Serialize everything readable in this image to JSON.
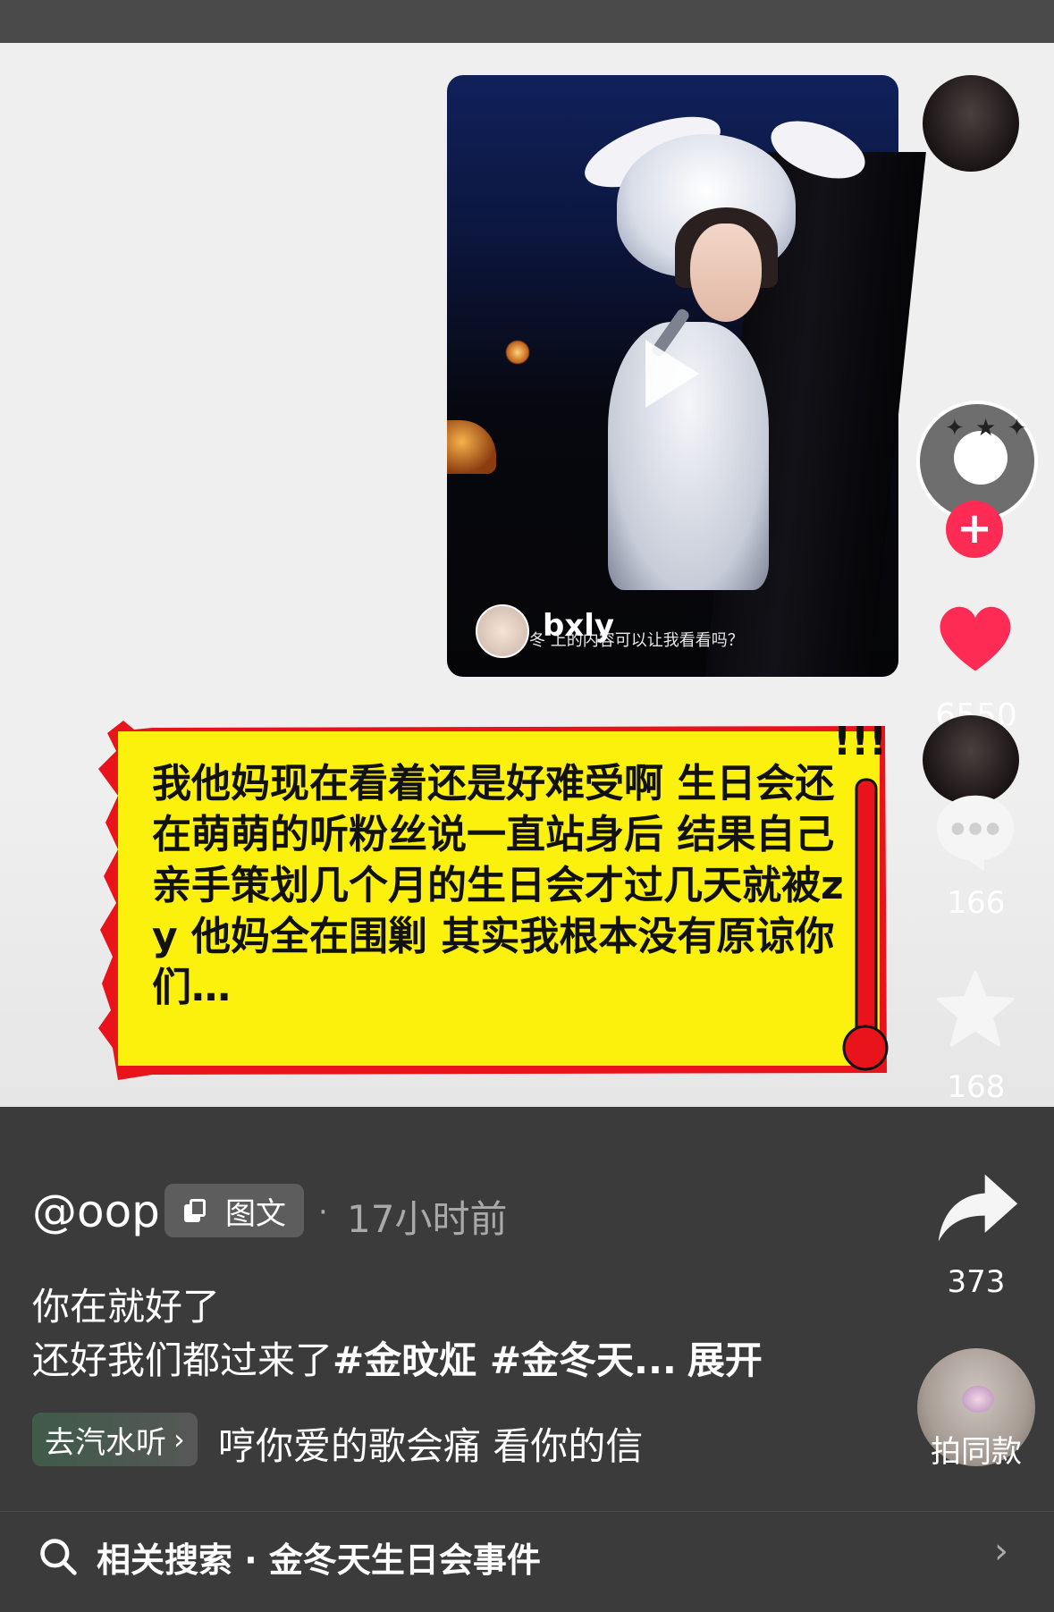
{
  "video_card": {
    "author_name": "bxly",
    "caption": "冬  上的内容可以让我看看吗？"
  },
  "sidebar": {
    "like_count": "6550",
    "comment_count": "166",
    "favorite_count": "168",
    "share_count": "373",
    "same_style_label": "拍同款"
  },
  "bubble": {
    "text": "我他妈现在看着还是好难受啊 生日会还在萌萌的听粉丝说一直站身后 结果自己亲手策划几个月的生日会才过几天就被zy 他妈全在围剿 其实我根本没有原谅你们…"
  },
  "post": {
    "username": "@oop",
    "type_label": "图文",
    "time_ago": "17小时前",
    "desc_line1": "你在就好了",
    "desc_line2_text": "还好我们都过来了",
    "desc_line2_tags": "#金旼炡 #金冬天...",
    "expand_label": "展开"
  },
  "music": {
    "chip_label": "去汽水听",
    "lyrics": "哼你爱的歌会痛 看你的信"
  },
  "related": {
    "label": "相关搜索 · 金冬天生日会事件"
  },
  "colors": {
    "accent_red": "#fe2c55",
    "bubble_yellow": "#fbf10d",
    "bubble_border": "#e8131b"
  }
}
